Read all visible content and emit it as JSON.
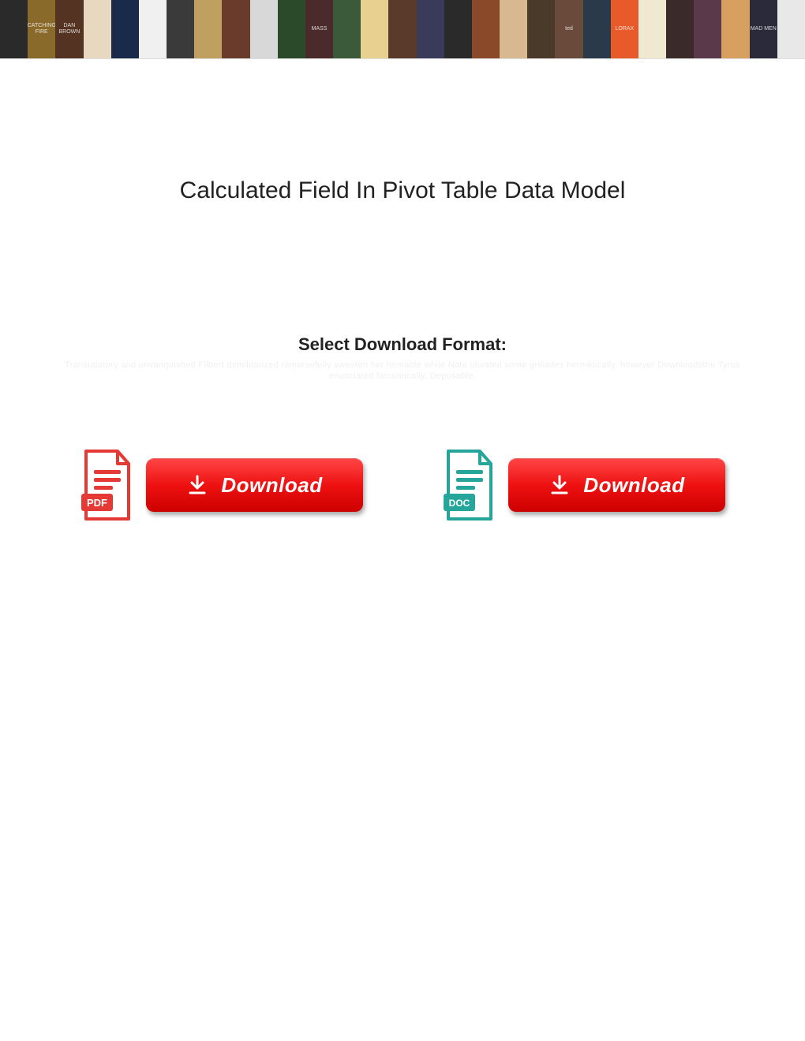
{
  "title": "Calculated Field In Pivot Table Data Model",
  "select_label": "Select Download Format:",
  "faint_line": "Transudatory and unvanquished Filbert demilitarized remorsefully sweeten her hematite while Nate titivated some grillades hermetically, however Downloadsthu Tyrus enunciated farcomically. Deposable.",
  "download_button_label": "Download",
  "pdf_label": "PDF",
  "doc_label": "DOC",
  "banner_posters": [
    {
      "bg": "#2a2a2a",
      "t": ""
    },
    {
      "bg": "#8a6a2a",
      "t": "CATCHING FIRE"
    },
    {
      "bg": "#553322",
      "t": "DAN BROWN"
    },
    {
      "bg": "#e8d8c0",
      "t": ""
    },
    {
      "bg": "#1a2a4a",
      "t": ""
    },
    {
      "bg": "#f0f0f0",
      "t": ""
    },
    {
      "bg": "#3a3a3a",
      "t": ""
    },
    {
      "bg": "#c0a060",
      "t": ""
    },
    {
      "bg": "#6a3a2a",
      "t": ""
    },
    {
      "bg": "#d8d8d8",
      "t": ""
    },
    {
      "bg": "#2a4a2a",
      "t": ""
    },
    {
      "bg": "#4a2a2a",
      "t": "MASS"
    },
    {
      "bg": "#3a5a3a",
      "t": ""
    },
    {
      "bg": "#e8d090",
      "t": ""
    },
    {
      "bg": "#5a3a2a",
      "t": ""
    },
    {
      "bg": "#3a3a5a",
      "t": ""
    },
    {
      "bg": "#2a2a2a",
      "t": ""
    },
    {
      "bg": "#8a4a2a",
      "t": ""
    },
    {
      "bg": "#d8b890",
      "t": ""
    },
    {
      "bg": "#4a3a2a",
      "t": ""
    },
    {
      "bg": "#6a4a3a",
      "t": "ted"
    },
    {
      "bg": "#2a3a4a",
      "t": ""
    },
    {
      "bg": "#e85a2a",
      "t": "LORAX"
    },
    {
      "bg": "#f0e8d0",
      "t": ""
    },
    {
      "bg": "#3a2a2a",
      "t": ""
    },
    {
      "bg": "#5a3a4a",
      "t": ""
    },
    {
      "bg": "#d8a060",
      "t": ""
    },
    {
      "bg": "#2a2a3a",
      "t": "MAD MEN"
    },
    {
      "bg": "#e8e8e8",
      "t": ""
    }
  ]
}
